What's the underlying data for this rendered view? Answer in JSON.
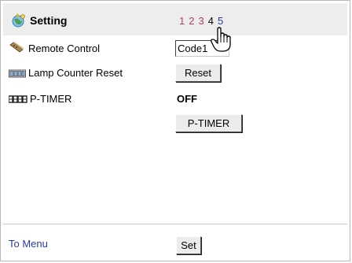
{
  "header": {
    "title": "Setting",
    "title_icon": "settings-globe-icon",
    "pages": [
      {
        "label": "1",
        "state": "inactive"
      },
      {
        "label": "2",
        "state": "inactive"
      },
      {
        "label": "3",
        "state": "inactive"
      },
      {
        "label": "4",
        "state": "current"
      },
      {
        "label": "5",
        "state": "link"
      }
    ],
    "cursor_icon": "hand-pointer-icon"
  },
  "rows": {
    "remote": {
      "label": "Remote Control",
      "icon": "remote-control-icon",
      "value": "Code1"
    },
    "lamp": {
      "label": "Lamp Counter Reset",
      "icon": "lamp-counter-icon",
      "button": "Reset"
    },
    "ptimer": {
      "label": "P-TIMER",
      "icon": "timer-display-icon",
      "value": "OFF",
      "button": "P-TIMER"
    }
  },
  "footer": {
    "menu_link": "To Menu",
    "set_button": "Set"
  },
  "colors": {
    "header_bg": "#ededed",
    "inactive_page": "#b0405a",
    "link": "#2a3ba0"
  }
}
